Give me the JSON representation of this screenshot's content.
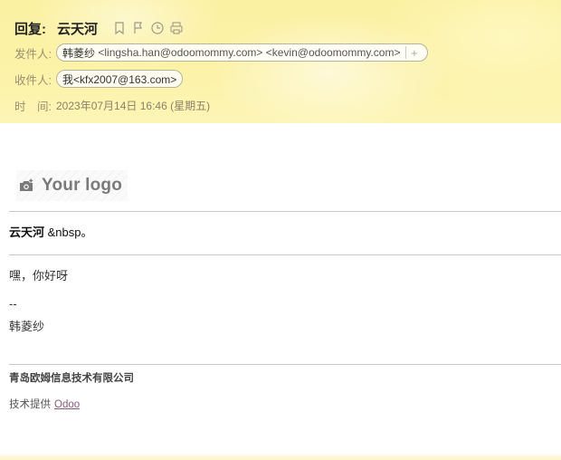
{
  "header": {
    "reply_label": "回复:",
    "subject": "云天河",
    "icons": [
      "bookmark-icon",
      "flag-icon",
      "clock-icon",
      "print-icon"
    ],
    "from_label": "发件人:",
    "from_name": "韩菱纱",
    "from_addr": "<lingsha.han@odoomommy.com>",
    "from_extra": "<kevin@odoomommy.com>",
    "from_add": "+",
    "to_label": "收件人:",
    "to_chip": "我<kfx2007@163.com>",
    "time_label": "时　间:",
    "time_value": "2023年07月14日 16:46 (星期五)"
  },
  "body": {
    "logo_text": "Your logo",
    "greeting_name": "云天河",
    "greeting_rest": " &nbsp。",
    "message": "嘿，你好呀",
    "signature_sep": "--",
    "signature_name": "韩菱纱",
    "company": "青岛欧姆信息技术有限公司",
    "powered_by": "技术提供",
    "powered_link": "Odoo"
  },
  "colors": {
    "header_bg": "#fcf2a8",
    "odoo_link": "#875a7b"
  }
}
